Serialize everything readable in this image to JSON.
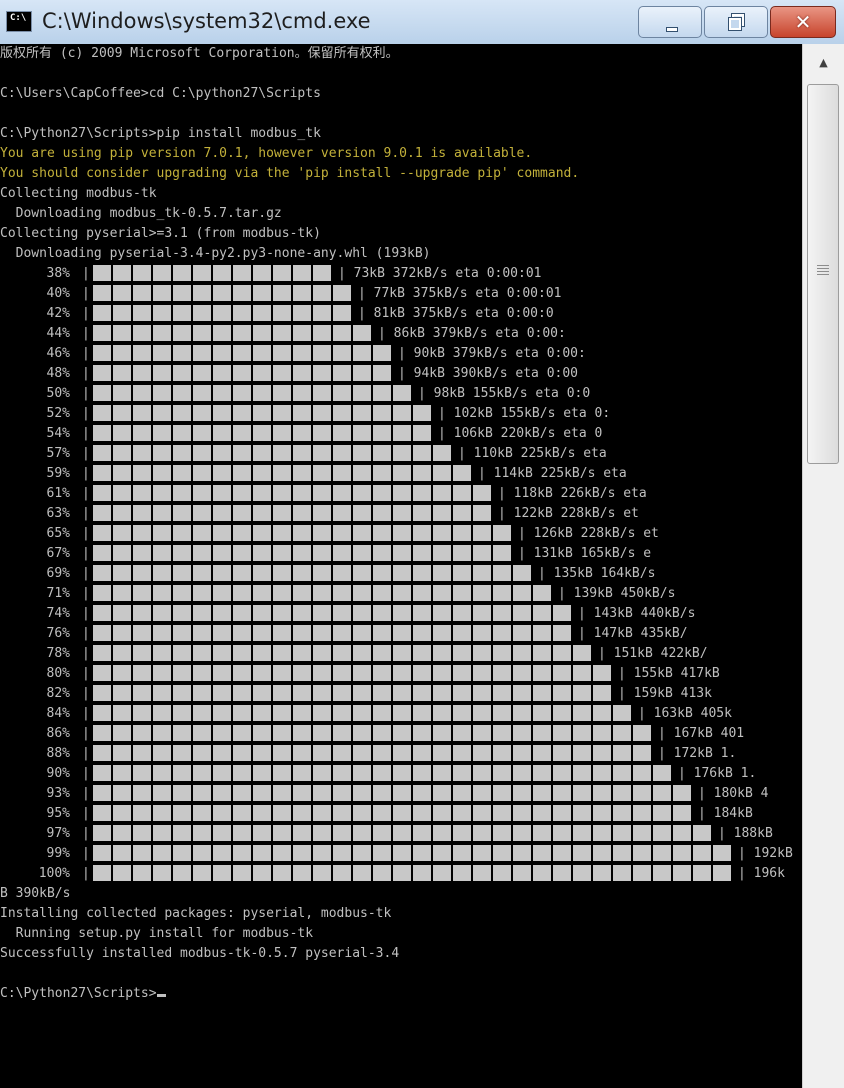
{
  "window": {
    "title": "C:\\Windows\\system32\\cmd.exe",
    "icon": "cmd-icon",
    "buttons": {
      "minimize": "minimize-icon",
      "maximize": "restore-icon",
      "close": "✕"
    }
  },
  "console": {
    "lines_top": [
      {
        "text": "版权所有 (c) 2009 Microsoft Corporation。保留所有权利。",
        "color": "gray"
      },
      {
        "text": "",
        "color": "gray"
      },
      {
        "text": "C:\\Users\\CapCoffee>cd C:\\python27\\Scripts",
        "color": "gray"
      },
      {
        "text": "",
        "color": "gray"
      },
      {
        "text": "C:\\Python27\\Scripts>pip install modbus_tk",
        "color": "gray"
      },
      {
        "text": "You are using pip version 7.0.1, however version 9.0.1 is available.",
        "color": "yellow"
      },
      {
        "text": "You should consider upgrading via the 'pip install --upgrade pip' command.",
        "color": "yellow"
      },
      {
        "text": "Collecting modbus-tk",
        "color": "gray"
      },
      {
        "text": "  Downloading modbus_tk-0.5.7.tar.gz",
        "color": "gray"
      },
      {
        "text": "Collecting pyserial>=3.1 (from modbus-tk)",
        "color": "gray"
      },
      {
        "text": "  Downloading pyserial-3.4-py2.py3-none-any.whl (193kB)",
        "color": "gray"
      }
    ],
    "progress_rows": [
      {
        "pct": "38%",
        "level": 0.38,
        "status": "| 73kB 372kB/s eta 0:00:01"
      },
      {
        "pct": "40%",
        "level": 0.4,
        "status": "| 77kB 375kB/s eta 0:00:01"
      },
      {
        "pct": "42%",
        "level": 0.42,
        "status": "| 81kB 375kB/s eta 0:00:0"
      },
      {
        "pct": "44%",
        "level": 0.44,
        "status": "| 86kB 379kB/s eta 0:00:"
      },
      {
        "pct": "46%",
        "level": 0.46,
        "status": "| 90kB 379kB/s eta 0:00:"
      },
      {
        "pct": "48%",
        "level": 0.48,
        "status": "| 94kB 390kB/s eta 0:00"
      },
      {
        "pct": "50%",
        "level": 0.5,
        "status": "| 98kB 155kB/s eta 0:0"
      },
      {
        "pct": "52%",
        "level": 0.52,
        "status": "| 102kB 155kB/s eta 0:"
      },
      {
        "pct": "54%",
        "level": 0.54,
        "status": "| 106kB 220kB/s eta 0"
      },
      {
        "pct": "57%",
        "level": 0.57,
        "status": "| 110kB 225kB/s eta"
      },
      {
        "pct": "59%",
        "level": 0.59,
        "status": "| 114kB 225kB/s eta"
      },
      {
        "pct": "61%",
        "level": 0.61,
        "status": "| 118kB 226kB/s eta"
      },
      {
        "pct": "63%",
        "level": 0.63,
        "status": "| 122kB 228kB/s et"
      },
      {
        "pct": "65%",
        "level": 0.65,
        "status": "| 126kB 228kB/s et"
      },
      {
        "pct": "67%",
        "level": 0.67,
        "status": "| 131kB 165kB/s e"
      },
      {
        "pct": "69%",
        "level": 0.69,
        "status": "| 135kB 164kB/s"
      },
      {
        "pct": "71%",
        "level": 0.71,
        "status": "| 139kB 450kB/s"
      },
      {
        "pct": "74%",
        "level": 0.74,
        "status": "| 143kB 440kB/s"
      },
      {
        "pct": "76%",
        "level": 0.76,
        "status": "| 147kB 435kB/"
      },
      {
        "pct": "78%",
        "level": 0.78,
        "status": "| 151kB 422kB/"
      },
      {
        "pct": "80%",
        "level": 0.8,
        "status": "| 155kB 417kB"
      },
      {
        "pct": "82%",
        "level": 0.82,
        "status": "| 159kB 413k"
      },
      {
        "pct": "84%",
        "level": 0.84,
        "status": "| 163kB 405k"
      },
      {
        "pct": "86%",
        "level": 0.86,
        "status": "| 167kB 401"
      },
      {
        "pct": "88%",
        "level": 0.88,
        "status": "| 172kB 1."
      },
      {
        "pct": "90%",
        "level": 0.9,
        "status": "| 176kB 1."
      },
      {
        "pct": "93%",
        "level": 0.93,
        "status": "| 180kB 4"
      },
      {
        "pct": "95%",
        "level": 0.95,
        "status": "| 184kB"
      },
      {
        "pct": "97%",
        "level": 0.97,
        "status": "| 188kB"
      },
      {
        "pct": "99%",
        "level": 0.99,
        "status": "| 192kB"
      },
      {
        "pct": "100%",
        "level": 1.0,
        "status": "| 196k"
      }
    ],
    "lines_bottom": [
      {
        "text": "B 390kB/s",
        "color": "gray"
      },
      {
        "text": "Installing collected packages: pyserial, modbus-tk",
        "color": "gray"
      },
      {
        "text": "  Running setup.py install for modbus-tk",
        "color": "gray"
      },
      {
        "text": "Successfully installed modbus-tk-0.5.7 pyserial-3.4",
        "color": "gray"
      },
      {
        "text": "",
        "color": "gray"
      },
      {
        "text": "C:\\Python27\\Scripts>",
        "color": "gray"
      }
    ],
    "colors": {
      "background": "#000000",
      "text": "#c0c0c0",
      "warning": "#c3b13a",
      "bar_cell": "#c8c8c8"
    }
  },
  "scrollbar": {
    "up_arrow": "▲"
  }
}
